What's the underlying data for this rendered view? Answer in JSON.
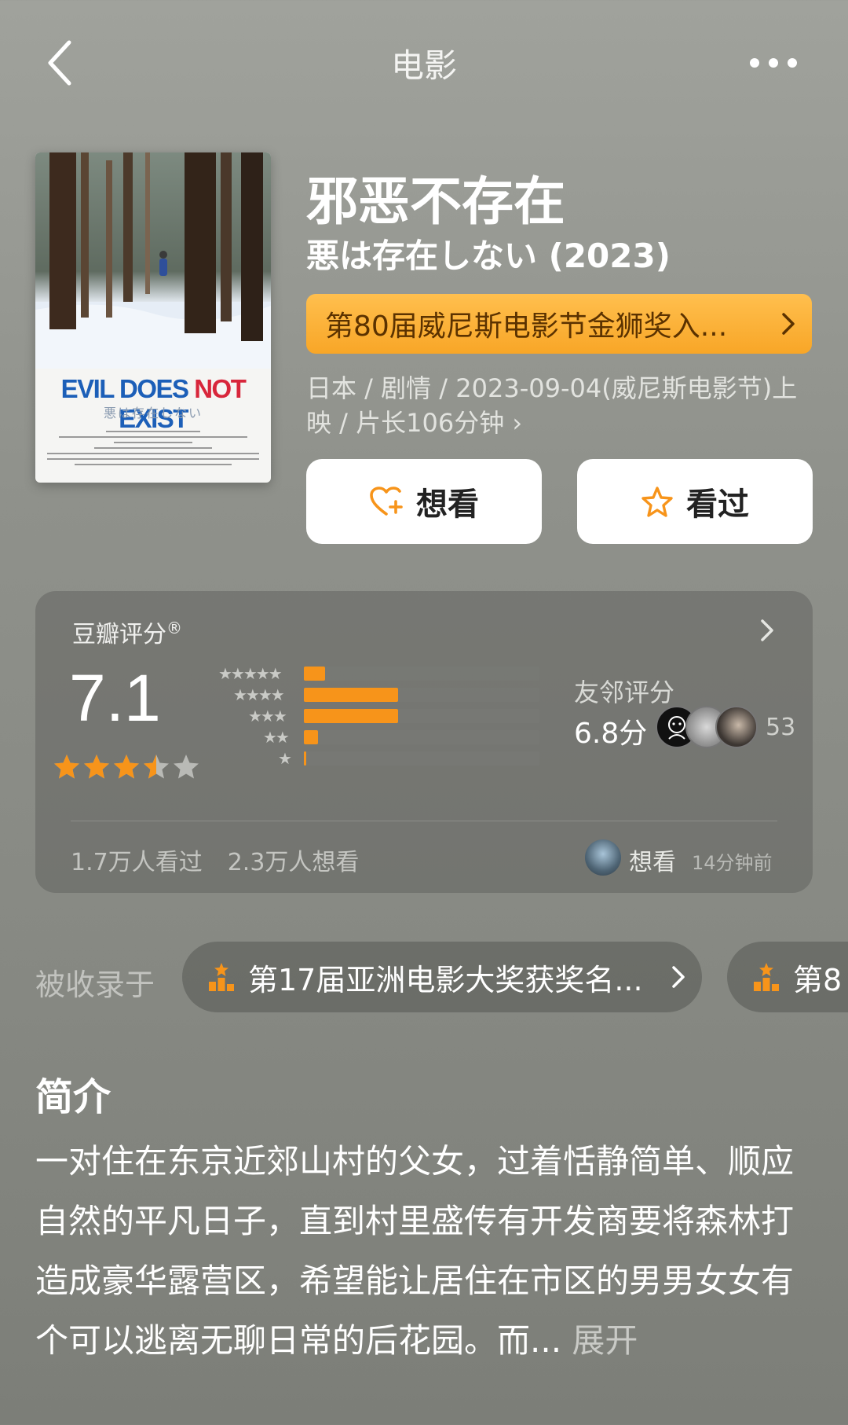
{
  "header": {
    "title": "电影",
    "back_icon": "chevron-left-icon",
    "more_icon": "more-dots-icon"
  },
  "poster": {
    "title_blue_1": "EVIL DOES ",
    "title_red": "NOT",
    "title_blue_2": " EXIST",
    "subtitle": "悪は存在しない"
  },
  "movie": {
    "title": "邪恶不存在",
    "original_title": "悪は存在しない (2023)",
    "award_banner": "第80届威尼斯电影节金狮奖入...",
    "meta": "日本 / 剧情 / 2023-09-04(威尼斯电影节)上映 / 片长106分钟 ›"
  },
  "actions": {
    "want_label": "想看",
    "seen_label": "看过"
  },
  "rating": {
    "label": "豆瓣评分",
    "reg_mark": "®",
    "score": "7.1",
    "stars_value": 3.5,
    "distribution": [
      {
        "stars": "★★★★★",
        "fraction": 0.09
      },
      {
        "stars": "★★★★",
        "fraction": 0.4
      },
      {
        "stars": "★★★",
        "fraction": 0.4
      },
      {
        "stars": "★★",
        "fraction": 0.06
      },
      {
        "stars": "★",
        "fraction": 0.01
      }
    ],
    "friend_label": "友邻评分",
    "friend_score": "6.8分",
    "friend_count": "53",
    "seen_count": "1.7万人看过",
    "want_count": "2.3万人想看",
    "recent_action": "想看",
    "recent_time": "14分钟前"
  },
  "collections": {
    "label": "被收录于",
    "items": [
      {
        "text": "第17届亚洲电影大奖获奖名..."
      },
      {
        "text": "第8"
      }
    ]
  },
  "synopsis": {
    "title": "简介",
    "text": "一对住在东京近郊山村的父女，过着恬静简单、顺应自然的平凡日子，直到村里盛传有开发商要将森林打造成豪华露营区，希望能让居住在市区的男男女女有个可以逃离无聊日常的后花园。而...",
    "more": "展开"
  },
  "colors": {
    "accent": "#f7941a",
    "banner": "#f8a627",
    "background": "#8f918b"
  }
}
